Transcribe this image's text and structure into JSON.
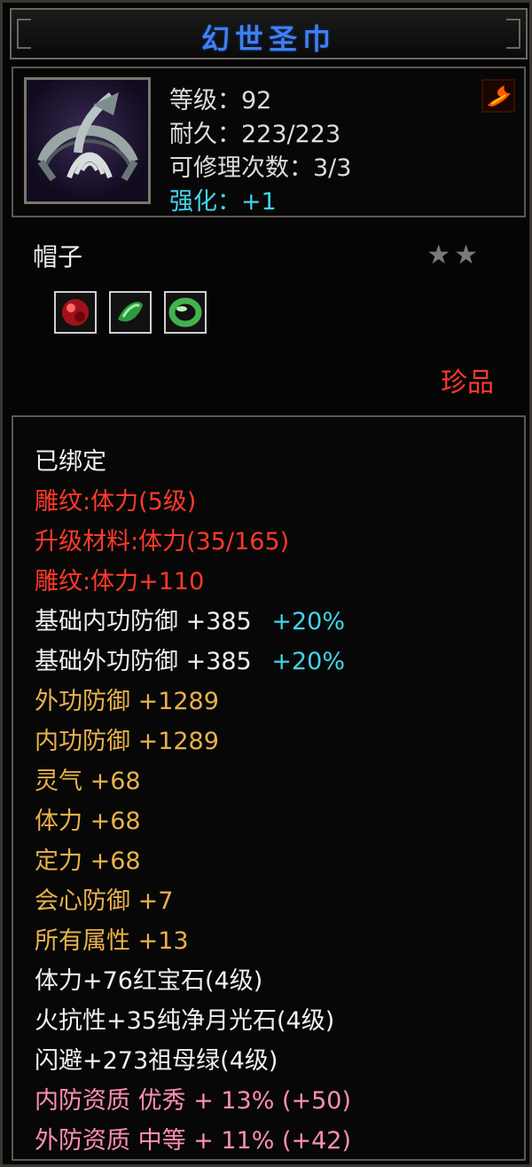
{
  "item": {
    "name": "幻世圣巾",
    "level": "等级：92",
    "durability": "耐久：223/223",
    "repair": "可修理次数：3/3",
    "enhance": "强化：+1",
    "type": "帽子",
    "rarity": "珍品",
    "stars": "★★",
    "gems": [
      "ruby-gem-icon",
      "emerald-gem-icon",
      "jade-ring-icon"
    ]
  },
  "attributes": [
    {
      "text": "已绑定",
      "color": "white"
    },
    {
      "text": "雕纹:体力(5级)",
      "color": "red"
    },
    {
      "text": "升级材料:体力(35/165)",
      "color": "red"
    },
    {
      "text": "雕纹:体力+110",
      "color": "red"
    },
    {
      "text": "基础内功防御 +385",
      "extra": "+20%",
      "color": "white"
    },
    {
      "text": "基础外功防御 +385",
      "extra": "+20%",
      "color": "white"
    },
    {
      "text": "外功防御 +1289",
      "color": "yellow"
    },
    {
      "text": "内功防御 +1289",
      "color": "yellow"
    },
    {
      "text": "灵气 +68",
      "color": "yellow"
    },
    {
      "text": "体力 +68",
      "color": "yellow"
    },
    {
      "text": "定力 +68",
      "color": "yellow"
    },
    {
      "text": "会心防御 +7",
      "color": "yellow"
    },
    {
      "text": "所有属性 +13",
      "color": "yellow"
    },
    {
      "text": "体力+76红宝石(4级)",
      "color": "white"
    },
    {
      "text": "火抗性+35纯净月光石(4级)",
      "color": "white"
    },
    {
      "text": "闪避+273祖母绿(4级)",
      "color": "white"
    },
    {
      "text": "内防资质 优秀 + 13% (+50)",
      "color": "pink"
    },
    {
      "text": "外防资质 中等 + 11% (+42)",
      "color": "pink"
    }
  ],
  "colors": {
    "title": "#3f7ff0",
    "red": "#ff3a2a",
    "yellow": "#e9b24a",
    "pink": "#ff8fb0",
    "cyan": "#40d6e8"
  }
}
